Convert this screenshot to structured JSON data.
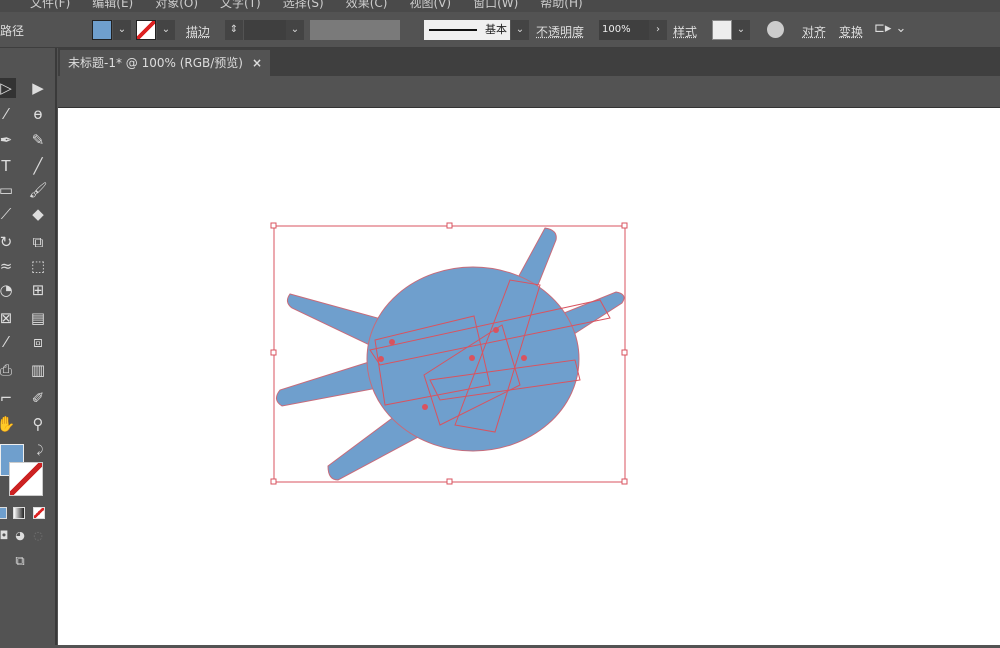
{
  "menu": [
    "文件(F)",
    "编辑(E)",
    "对象(O)",
    "文字(T)",
    "选择(S)",
    "效果(C)",
    "视图(V)",
    "窗口(W)",
    "帮助(H)"
  ],
  "control": {
    "object_type": "路径",
    "stroke_label": "描边",
    "stroke_profile": "基本",
    "opacity_label": "不透明度",
    "opacity_value": "100%",
    "style_label": "样式",
    "align_label": "对齐",
    "transform_label": "变换",
    "fill_color": "#6f9fcd"
  },
  "tab": {
    "title": "未标题-1* @ 100% (RGB/预览)",
    "close": "×"
  },
  "colors": {
    "fill": "#6f9fcd",
    "selection": "#d9535f",
    "canvas": "#ffffff"
  }
}
